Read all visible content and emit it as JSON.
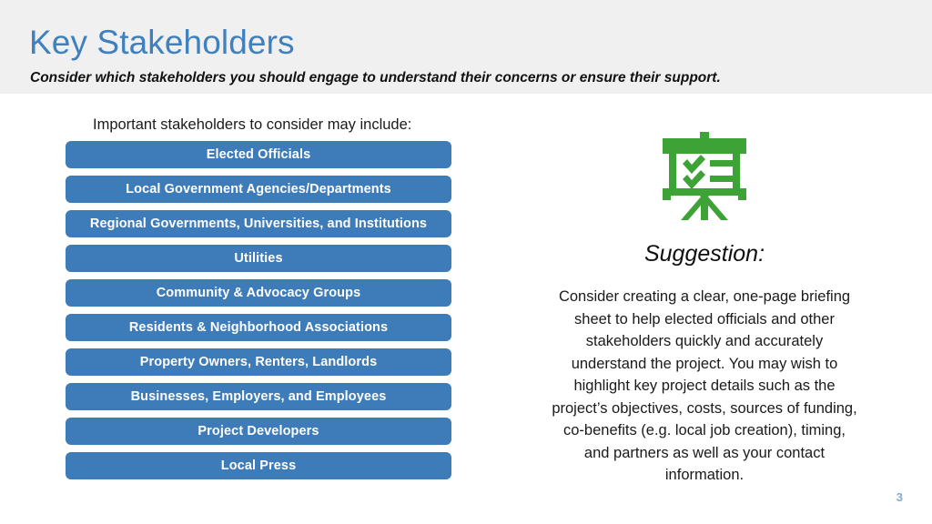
{
  "header": {
    "title": "Key Stakeholders",
    "subtitle": "Consider which stakeholders you should engage to understand their concerns or ensure their support.",
    "band_color": "#f0f0f0",
    "title_color": "#4080bf"
  },
  "left": {
    "intro": "Important stakeholders to consider may include:",
    "bar_color": "#3d7bb9",
    "bar_text_color": "#ffffff",
    "stakeholders": [
      "Elected Officials",
      "Local Government Agencies/Departments",
      "Regional Governments, Universities, and Institutions",
      "Utilities",
      "Community & Advocacy Groups",
      "Residents & Neighborhood Associations",
      "Property Owners, Renters, Landlords",
      "Businesses, Employers, and Employees",
      "Project Developers",
      "Local Press"
    ]
  },
  "right": {
    "icon_name": "presentation-board-checklist-icon",
    "icon_color": "#3ea337",
    "heading": "Suggestion:",
    "body": "Consider creating a clear, one-page briefing sheet to help elected officials and other stakeholders quickly and accurately understand the project. You may wish to highlight key project details such as the project’s objectives, costs, sources of funding, co-benefits (e.g. local job creation), timing, and partners as well as your contact information."
  },
  "footer": {
    "slide_number": "3",
    "slide_number_color": "#7fa9d4"
  }
}
